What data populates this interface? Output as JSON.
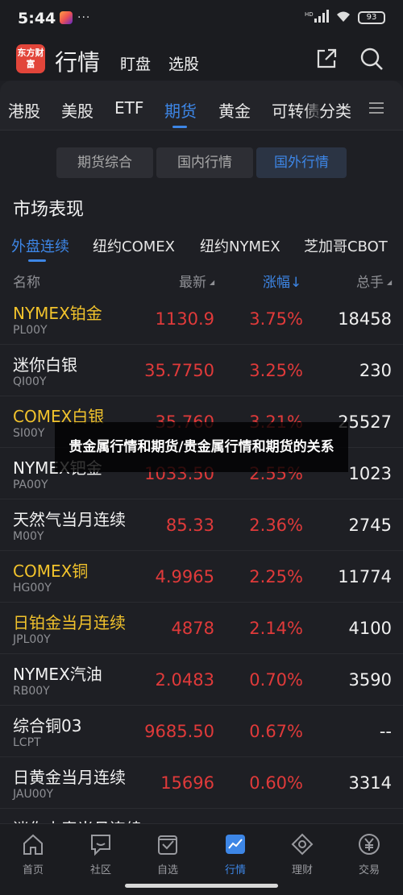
{
  "status": {
    "time": "5:44",
    "dots": "···",
    "battery": "93"
  },
  "header": {
    "logo_text": "东方财富",
    "title": "行情",
    "tab1": "盯盘",
    "tab2": "选股"
  },
  "categories": [
    "港股",
    "美股",
    "ETF",
    "期货",
    "黄金",
    "可转债",
    "分类"
  ],
  "segments": [
    "期货综合",
    "国内行情",
    "国外行情"
  ],
  "section_title": "市场表现",
  "sub_tabs": [
    "外盘连续",
    "纽约COMEX",
    "纽约NYMEX",
    "芝加哥CBOT"
  ],
  "columns": {
    "name": "名称",
    "latest": "最新",
    "change": "涨幅↓",
    "volume": "总手"
  },
  "rows": [
    {
      "name": "NYMEX铂金",
      "code": "PL00Y",
      "price": "1130.9",
      "change": "3.75%",
      "volume": "18458",
      "highlight": true
    },
    {
      "name": "迷你白银",
      "code": "QI00Y",
      "price": "35.7750",
      "change": "3.25%",
      "volume": "230",
      "highlight": false
    },
    {
      "name": "COMEX白银",
      "code": "SI00Y",
      "price": "35.760",
      "change": "3.21%",
      "volume": "25527",
      "highlight": true
    },
    {
      "name": "NYMEX钯金",
      "code": "PA00Y",
      "price": "1033.50",
      "change": "2.55%",
      "volume": "1023",
      "highlight": false
    },
    {
      "name": "天然气当月连续",
      "code": "M00Y",
      "price": "85.33",
      "change": "2.36%",
      "volume": "2745",
      "highlight": false
    },
    {
      "name": "COMEX铜",
      "code": "HG00Y",
      "price": "4.9965",
      "change": "2.25%",
      "volume": "11774",
      "highlight": true
    },
    {
      "name": "日铂金当月连续",
      "code": "JPL00Y",
      "price": "4878",
      "change": "2.14%",
      "volume": "4100",
      "highlight": true
    },
    {
      "name": "NYMEX汽油",
      "code": "RB00Y",
      "price": "2.0483",
      "change": "0.70%",
      "volume": "3590",
      "highlight": false
    },
    {
      "name": "综合铜03",
      "code": "LCPT",
      "price": "9685.50",
      "change": "0.67%",
      "volume": "--",
      "highlight": false
    },
    {
      "name": "日黄金当月连续",
      "code": "JAU00Y",
      "price": "15696",
      "change": "0.60%",
      "volume": "3314",
      "highlight": false
    },
    {
      "name": "迷你小麦当月连续",
      "code": "",
      "price": "",
      "change": "",
      "volume": "",
      "highlight": false
    }
  ],
  "overlay_text": "贵金属行情和期货/贵金属行情和期货的关系",
  "nav": [
    "首页",
    "社区",
    "自选",
    "行情",
    "理财",
    "交易"
  ],
  "colors": {
    "accent": "#3d86e6",
    "up_red": "#e03a3a",
    "highlight_gold": "#f2c32c",
    "background": "#1e1f24"
  }
}
